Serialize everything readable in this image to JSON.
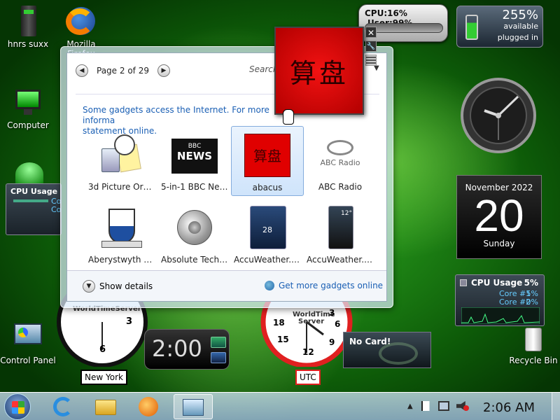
{
  "desktop": {
    "icons": [
      {
        "label": "hnrs suxx"
      },
      {
        "label": "Mozilla Firefox"
      },
      {
        "label": "Computer"
      },
      {
        "label": "Control Panel"
      },
      {
        "label": "Recycle Bin"
      }
    ]
  },
  "gallery": {
    "page_label": "Page 2 of 29",
    "search_placeholder": "Search",
    "notice_line1": "Some gadgets access the Internet.  For more informa",
    "notice_line2": "statement online.",
    "tiles": [
      {
        "label": "3d Picture Orb ..."
      },
      {
        "label": "5-in-1 BBC New..."
      },
      {
        "label": "abacus"
      },
      {
        "label": "ABC Radio"
      },
      {
        "label": "Aberystwyth W..."
      },
      {
        "label": "Absolute Techn..."
      },
      {
        "label": "AccuWeather.c..."
      },
      {
        "label": "AccuWeather.c..."
      }
    ],
    "show_details": "Show details",
    "get_more": "Get more gadgets online",
    "bbc_line1": "BBC",
    "bbc_line2": "NEWS",
    "abc_text": "ABC Radio",
    "abacus_chars": "算盘",
    "accu_temp": "28",
    "accu_temp2": "12°"
  },
  "dragged_gadget": {
    "chars": "算盘"
  },
  "meters": {
    "cpu": "CPU:16%",
    "user": "User:99%"
  },
  "battery": {
    "percent": "255%",
    "available": "available",
    "status": "plugged in"
  },
  "calendar": {
    "month": "November 2022",
    "day": "20",
    "weekday": "Sunday"
  },
  "cpu_widget": {
    "title": "CPU Usage",
    "total": "5%",
    "core1_label": "Core #1",
    "core1": "5%",
    "core2_label": "Core #2",
    "core2": "0%"
  },
  "cpu_small": {
    "title": "CPU Usage",
    "core1_label": "Co",
    "core2_label": "Co"
  },
  "clocks": {
    "new_york": "New York",
    "utc": "UTC",
    "brand": "WorldTimeServer",
    "brand_line1": "WorldTime",
    "brand_line2": "Server",
    "nums_ny": [
      "3",
      "6"
    ],
    "nums_utc": [
      "18",
      "3",
      "6",
      "15",
      "9",
      "12"
    ]
  },
  "digital_clock": {
    "time": "2:00"
  },
  "nocard": {
    "text": "No Card!"
  },
  "taskbar": {
    "time": "2:06 AM"
  },
  "colors": {
    "accent": "#1a5fb4",
    "abacus_red": "#e00000",
    "utc_red": "#e02020"
  }
}
